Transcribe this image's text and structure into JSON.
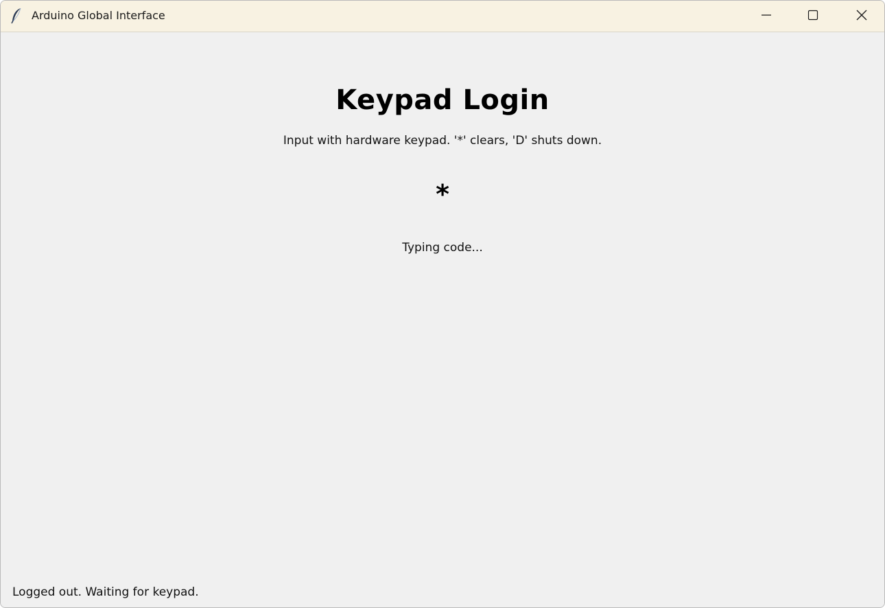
{
  "window": {
    "title": "Arduino Global Interface",
    "icon": "feather-icon",
    "controls": {
      "minimize_icon": "minimize-icon",
      "maximize_icon": "maximize-icon",
      "close_icon": "close-icon"
    }
  },
  "main": {
    "heading": "Keypad Login",
    "instructions": "Input with hardware keypad. '*' clears, 'D' shuts down.",
    "code_display": "*",
    "input_status": "Typing code..."
  },
  "footer": {
    "status": "Logged out. Waiting for keypad."
  },
  "colors": {
    "titlebar_bg": "#f8f2e2",
    "window_bg": "#f0f0f0",
    "text": "#000000"
  }
}
